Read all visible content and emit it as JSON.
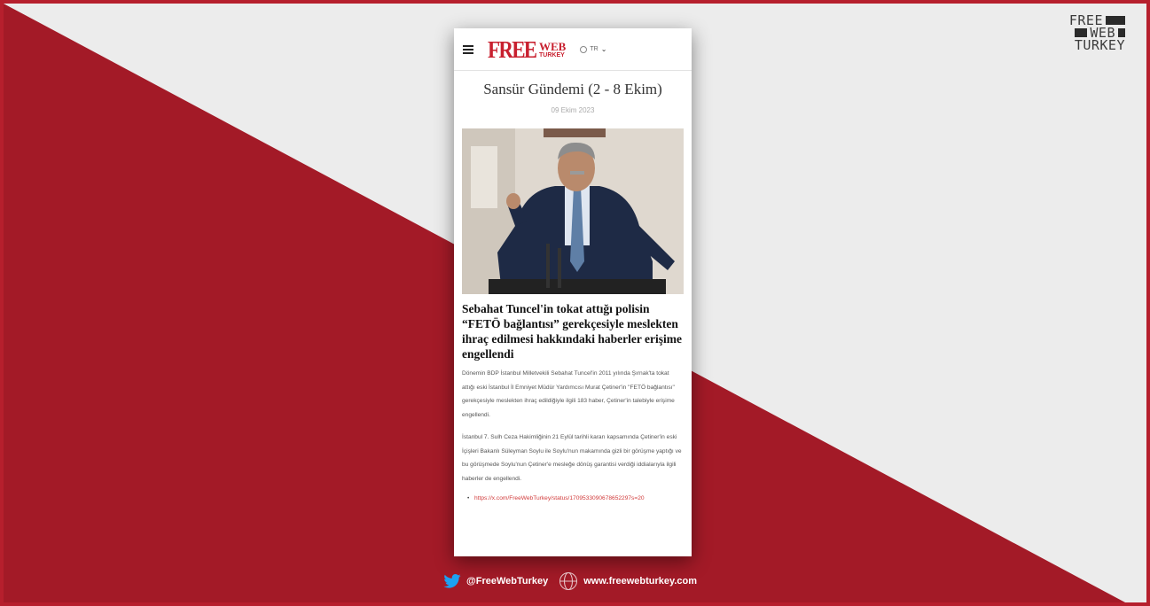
{
  "brand": {
    "line1": "FREE",
    "line2": "WEB",
    "line3": "TURKEY"
  },
  "site": {
    "logo_free": "FREE",
    "logo_web": "WEB",
    "logo_turkey": "TURKEY",
    "lang_label": "TR"
  },
  "article": {
    "title": "Sansür Gündemi (2 - 8 Ekim)",
    "date": "09 Ekim 2023",
    "headline": "Sebahat Tuncel'in tokat attığı polisin “FETÖ bağlantısı” gerekçesiyle meslekten ihraç edilmesi hakkındaki haberler erişime engellendi",
    "paragraph1": "Dönemin BDP İstanbul Milletvekili Sebahat Tuncel'in 2011 yılında Şırnak'ta tokat attığı eski İstanbul İl Emniyet Müdür Yardımcısı Murat Çetiner'in \"FETÖ bağlantısı\" gerekçesiyle meslekten ihraç edildiğiyle ilgili 183 haber, Çetiner'in talebiyle erişime engellendi.",
    "paragraph2": "İstanbul 7. Sulh Ceza Hakimliğinin 21 Eylül tarihli kararı kapsamında Çetiner'in eski İçişleri Bakanlı Süleyman Soylu ile Soylu'nun makamında gizli bir görüşme yaptığı ve bu görüşmede Soylu'nun Çetiner'e mesleğe dönüş garantisi verdiği iddialarıyla ilgili haberler de engellendi.",
    "link": "https://x.com/FreeWebTurkey/status/1709533090678652297s=20"
  },
  "footer": {
    "twitter_handle": "@FreeWebTurkey",
    "website": "www.freewebturkey.com"
  },
  "colors": {
    "brand_red": "#a31a27",
    "light_bg": "#ececec"
  },
  "icons": [
    "menu-icon",
    "globe-icon",
    "chevron-down-icon",
    "twitter-icon",
    "www-globe-icon"
  ]
}
